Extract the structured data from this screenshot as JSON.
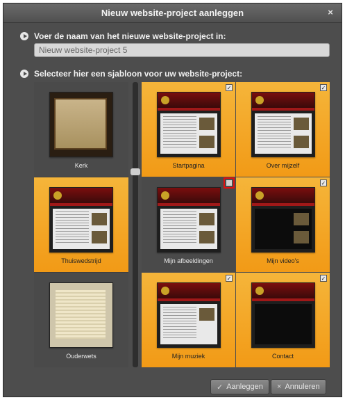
{
  "dialog": {
    "title": "Nieuw website-project aanleggen",
    "close_glyph": "×"
  },
  "name_section": {
    "label": "Voer de naam van het nieuwe website-project in:",
    "input_value": "Nieuw website-project 5"
  },
  "template_section": {
    "label": "Selecteer hier een sjabloon voor uw website-project:",
    "left_templates": [
      {
        "label": "Kerk",
        "selected": false
      },
      {
        "label": "Thuiswedstrijd",
        "selected": true
      },
      {
        "label": "Ouderwets",
        "selected": false
      }
    ],
    "pages": [
      {
        "label": "Startpagina",
        "checked": true
      },
      {
        "label": "Over mijzelf",
        "checked": true
      },
      {
        "label": "Mijn afbeeldingen",
        "checked": false
      },
      {
        "label": "Mijn video's",
        "checked": true
      },
      {
        "label": "Mijn muziek",
        "checked": true
      },
      {
        "label": "Contact",
        "checked": true
      }
    ]
  },
  "buttons": {
    "create_label": "Aanleggen",
    "cancel_label": "Annuleren"
  },
  "colors": {
    "selected_tile": "#f5a623",
    "dialog_background": "#4d4d4d",
    "highlight_outline": "#e01010"
  },
  "check_glyph": "✓"
}
